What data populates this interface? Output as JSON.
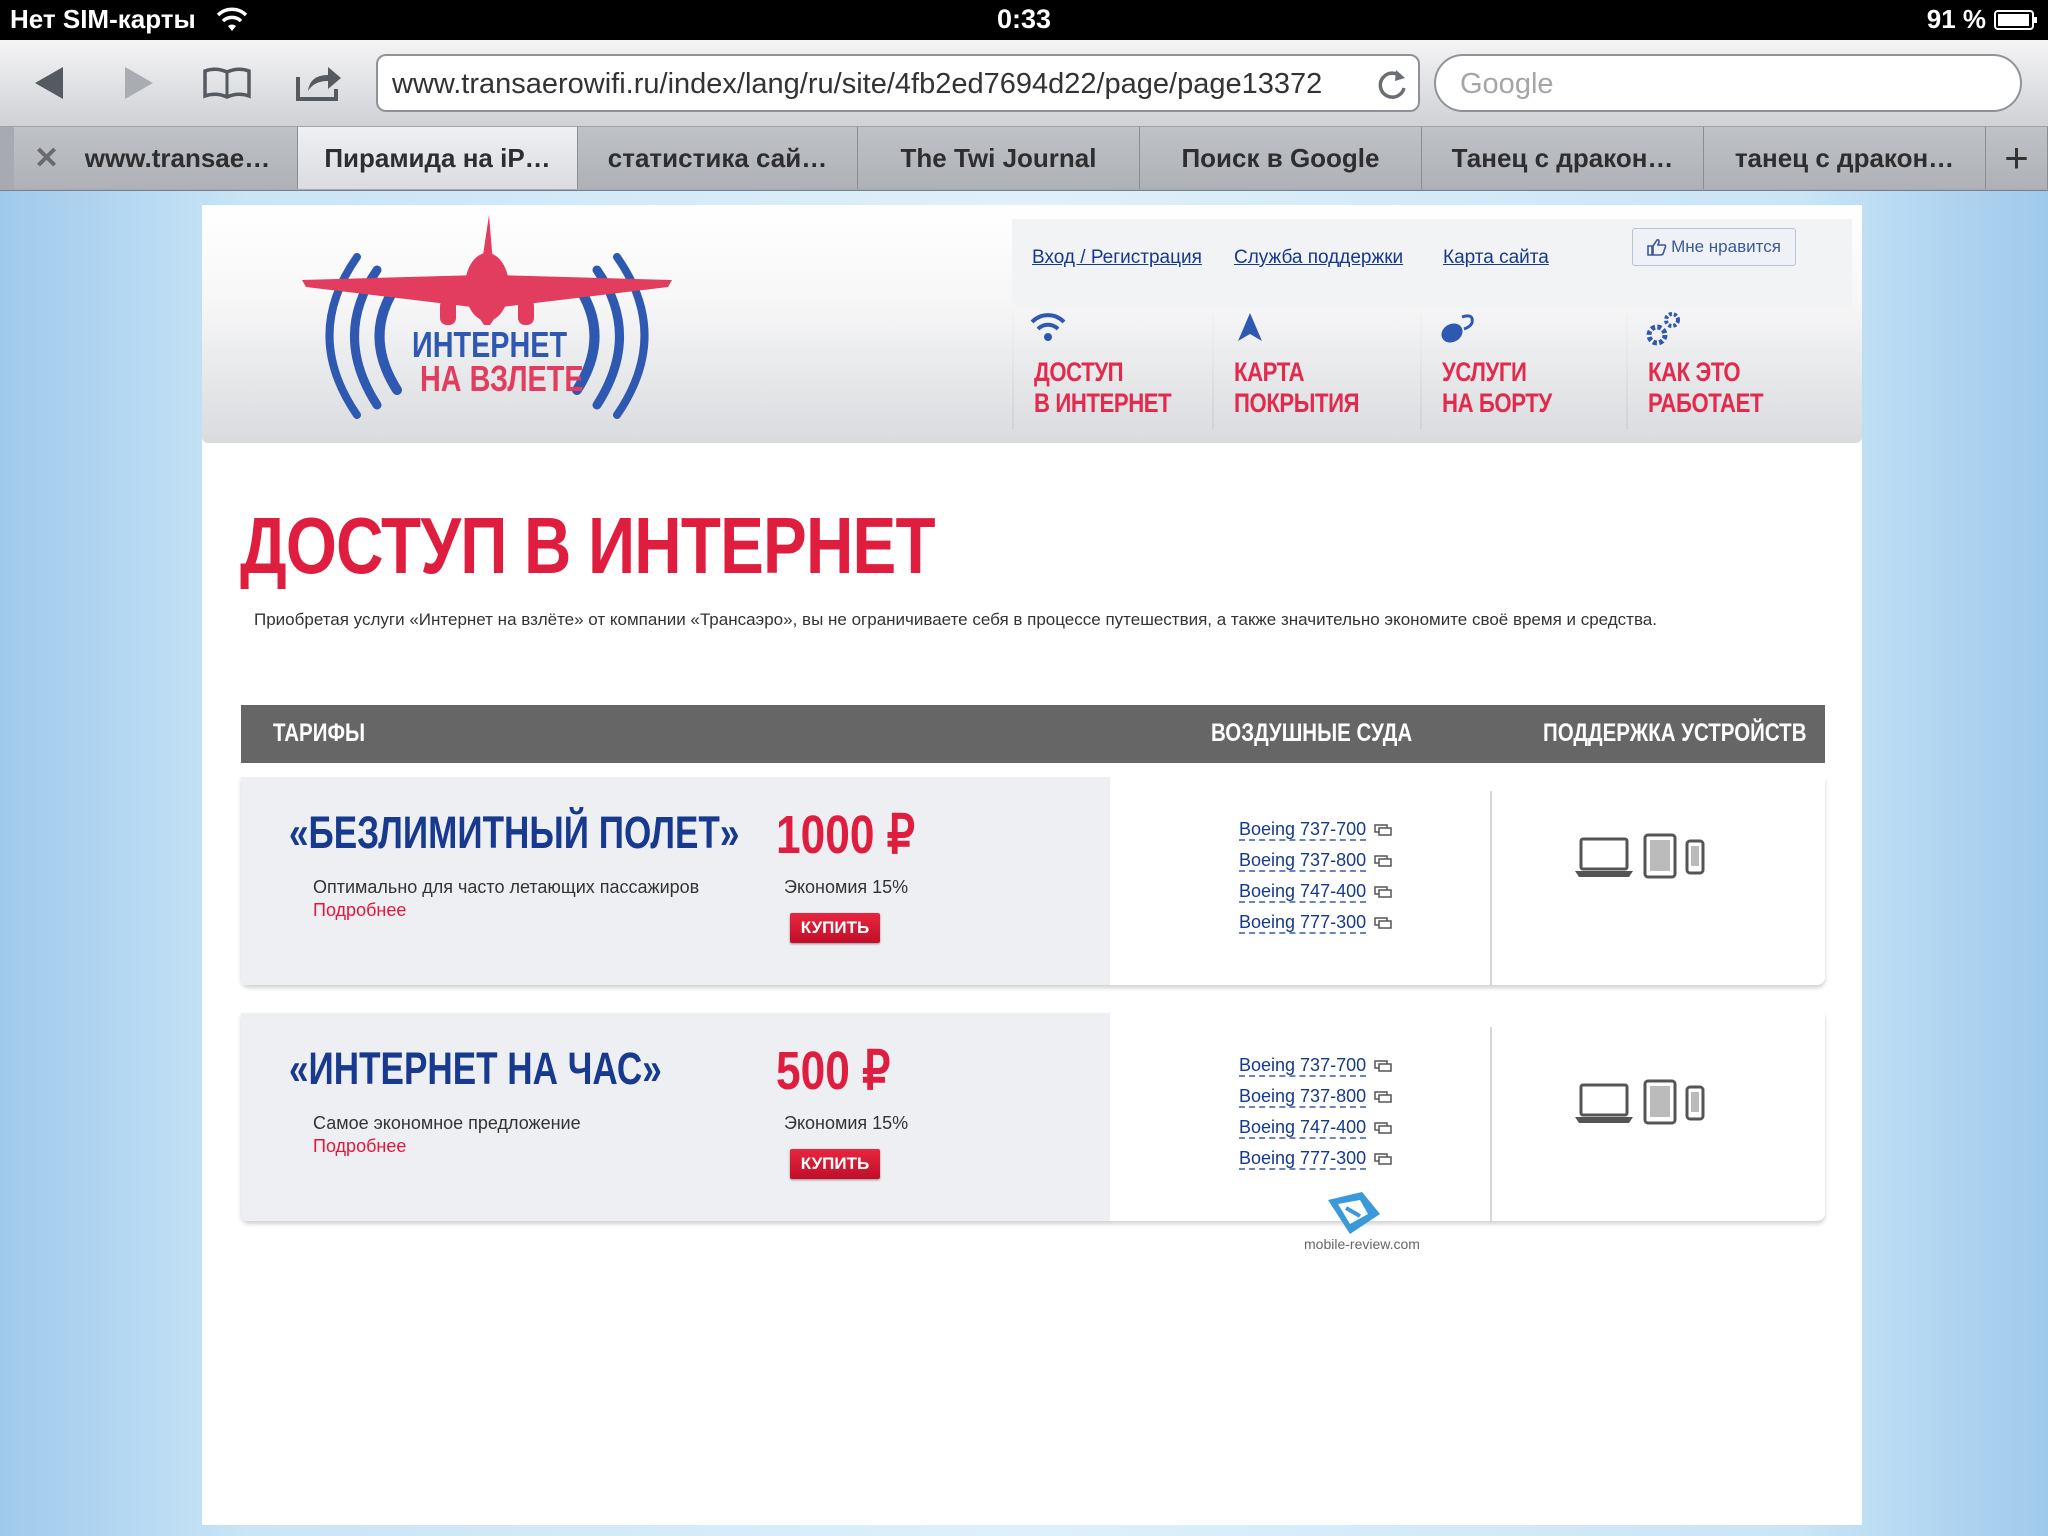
{
  "status_bar": {
    "carrier": "Нет SIM-карты",
    "time": "0:33",
    "battery": "91 %"
  },
  "browser": {
    "url": "www.transaerowifi.ru/index/lang/ru/site/4fb2ed7694d22/page/page13372",
    "search_placeholder": "Google",
    "tabs": [
      {
        "label": "www.transae…",
        "active": false
      },
      {
        "label": "Пирамида на iP…",
        "active": true
      },
      {
        "label": "статистика сай…",
        "active": false
      },
      {
        "label": "The Twi Journal",
        "active": false
      },
      {
        "label": "Поиск в Google",
        "active": false
      },
      {
        "label": "Танец с дракон…",
        "active": false
      },
      {
        "label": "танец с дракон…",
        "active": false
      }
    ],
    "new_tab": "+"
  },
  "site": {
    "logo": {
      "line1": "ИНТЕРНЕТ",
      "line2": "НА ВЗЛЕТЕ"
    },
    "top_links": {
      "login": "Вход / Регистрация",
      "support": "Служба поддержки",
      "sitemap": "Карта сайта",
      "like": "Мне нравится"
    },
    "nav": [
      {
        "line1": "ДОСТУП",
        "line2": "В ИНТЕРНЕТ",
        "icon": "wifi-icon"
      },
      {
        "line1": "КАРТА",
        "line2": "ПОКРЫТИЯ",
        "icon": "navigation-arrow-icon"
      },
      {
        "line1": "УСЛУГИ",
        "line2": "НА БОРТУ",
        "icon": "services-icon"
      },
      {
        "line1": "КАК ЭТО",
        "line2": "РАБОТАЕТ",
        "icon": "gears-icon"
      }
    ],
    "page_title": "ДОСТУП В ИНТЕРНЕТ",
    "intro": "Приобретая услуги «Интернет на взлёте» от компании «Трансаэро», вы не ограничиваете себя в процессе путешествия, а также значительно экономите своё время и средства.",
    "table_headers": {
      "tariffs": "ТАРИФЫ",
      "aircraft": "ВОЗДУШНЫЕ СУДА",
      "devices": "ПОДДЕРЖКА УСТРОЙСТВ"
    },
    "tariffs": [
      {
        "name": "«БЕЗЛИМИТНЫЙ ПОЛЕТ»",
        "desc": "Оптимально для часто летающих пассажиров",
        "more": "Подробнее",
        "price": "1000 ₽",
        "saving": "Экономия 15%",
        "buy": "КУПИТЬ",
        "aircraft": [
          "Boeing 737-700",
          "Boeing 737-800",
          "Boeing 747-400",
          "Boeing 777-300"
        ]
      },
      {
        "name": "«ИНТЕРНЕТ НА ЧАС»",
        "desc": "Самое экономное предложение",
        "more": "Подробнее",
        "price": "500 ₽",
        "saving": "Экономия 15%",
        "buy": "КУПИТЬ",
        "aircraft": [
          "Boeing 737-700",
          "Boeing 737-800",
          "Boeing 747-400",
          "Boeing 777-300"
        ]
      }
    ],
    "watermark": "mobile-review.com"
  },
  "colors": {
    "brand_red": "#df1d3e",
    "brand_blue": "#173a8f",
    "header_gray": "#666666"
  }
}
